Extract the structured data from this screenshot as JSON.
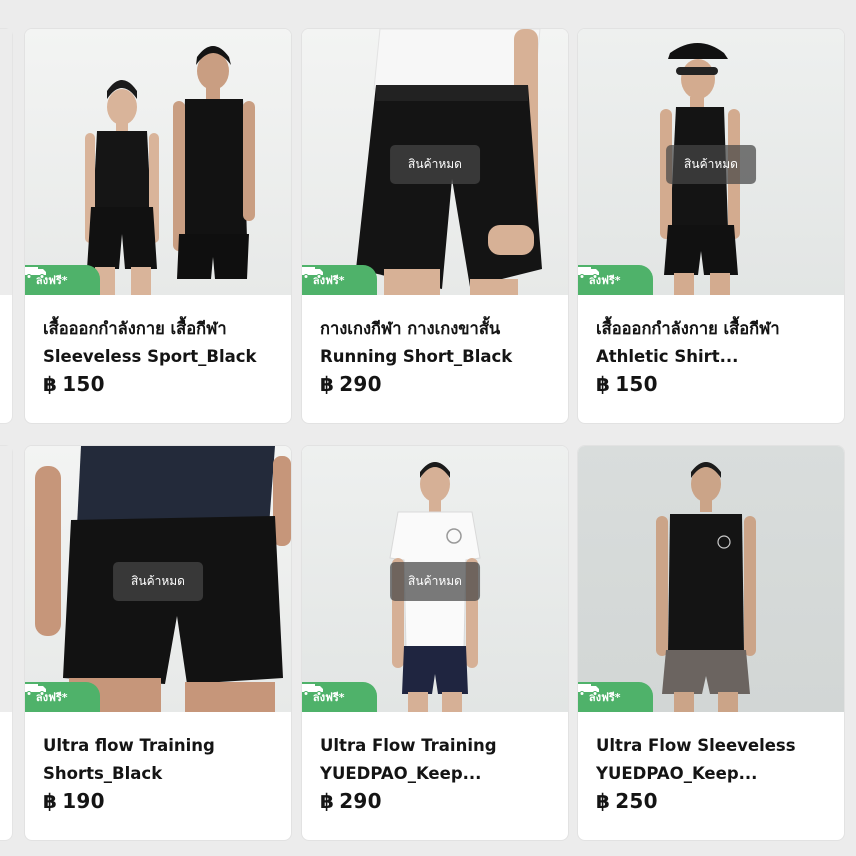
{
  "products": [
    {
      "name_line1": "เสื้อออกกำลังกาย เสื้อกีฬา",
      "name_line2": "Sleeveless Sport_Black",
      "currency": "฿",
      "price": "150",
      "sold_out": "",
      "badge": "ส่งฟรี*"
    },
    {
      "name_line1": "กางเกงกีฬา กางเกงขาสั้น",
      "name_line2": "Running Short_Black",
      "currency": "฿",
      "price": "290",
      "sold_out": "สินค้าหมด",
      "badge": "ส่งฟรี*"
    },
    {
      "name_line1": "เสื้อออกกำลังกาย เสื้อกีฬา",
      "name_line2": "Athletic Shirt...",
      "currency": "฿",
      "price": "150",
      "sold_out": "สินค้าหมด",
      "badge": "ส่งฟรี*"
    },
    {
      "name_line1": "Ultra flow Training",
      "name_line2": "Shorts_Black",
      "currency": "฿",
      "price": "190",
      "sold_out": "สินค้าหมด",
      "badge": "ส่งฟรี*"
    },
    {
      "name_line1": "Ultra Flow Training",
      "name_line2": "YUEDPAO_Keep...",
      "currency": "฿",
      "price": "290",
      "sold_out": "สินค้าหมด",
      "badge": "ส่งฟรี*"
    },
    {
      "name_line1": "Ultra Flow Sleeveless",
      "name_line2": "YUEDPAO_Keep...",
      "currency": "฿",
      "price": "250",
      "sold_out": "",
      "badge": "ส่งฟรี*"
    }
  ],
  "icons": {
    "badge_icon": "truck-icon"
  },
  "colors": {
    "badge_bg": "#4fb26a",
    "text": "#141414",
    "soldout_bg": "#464646"
  }
}
